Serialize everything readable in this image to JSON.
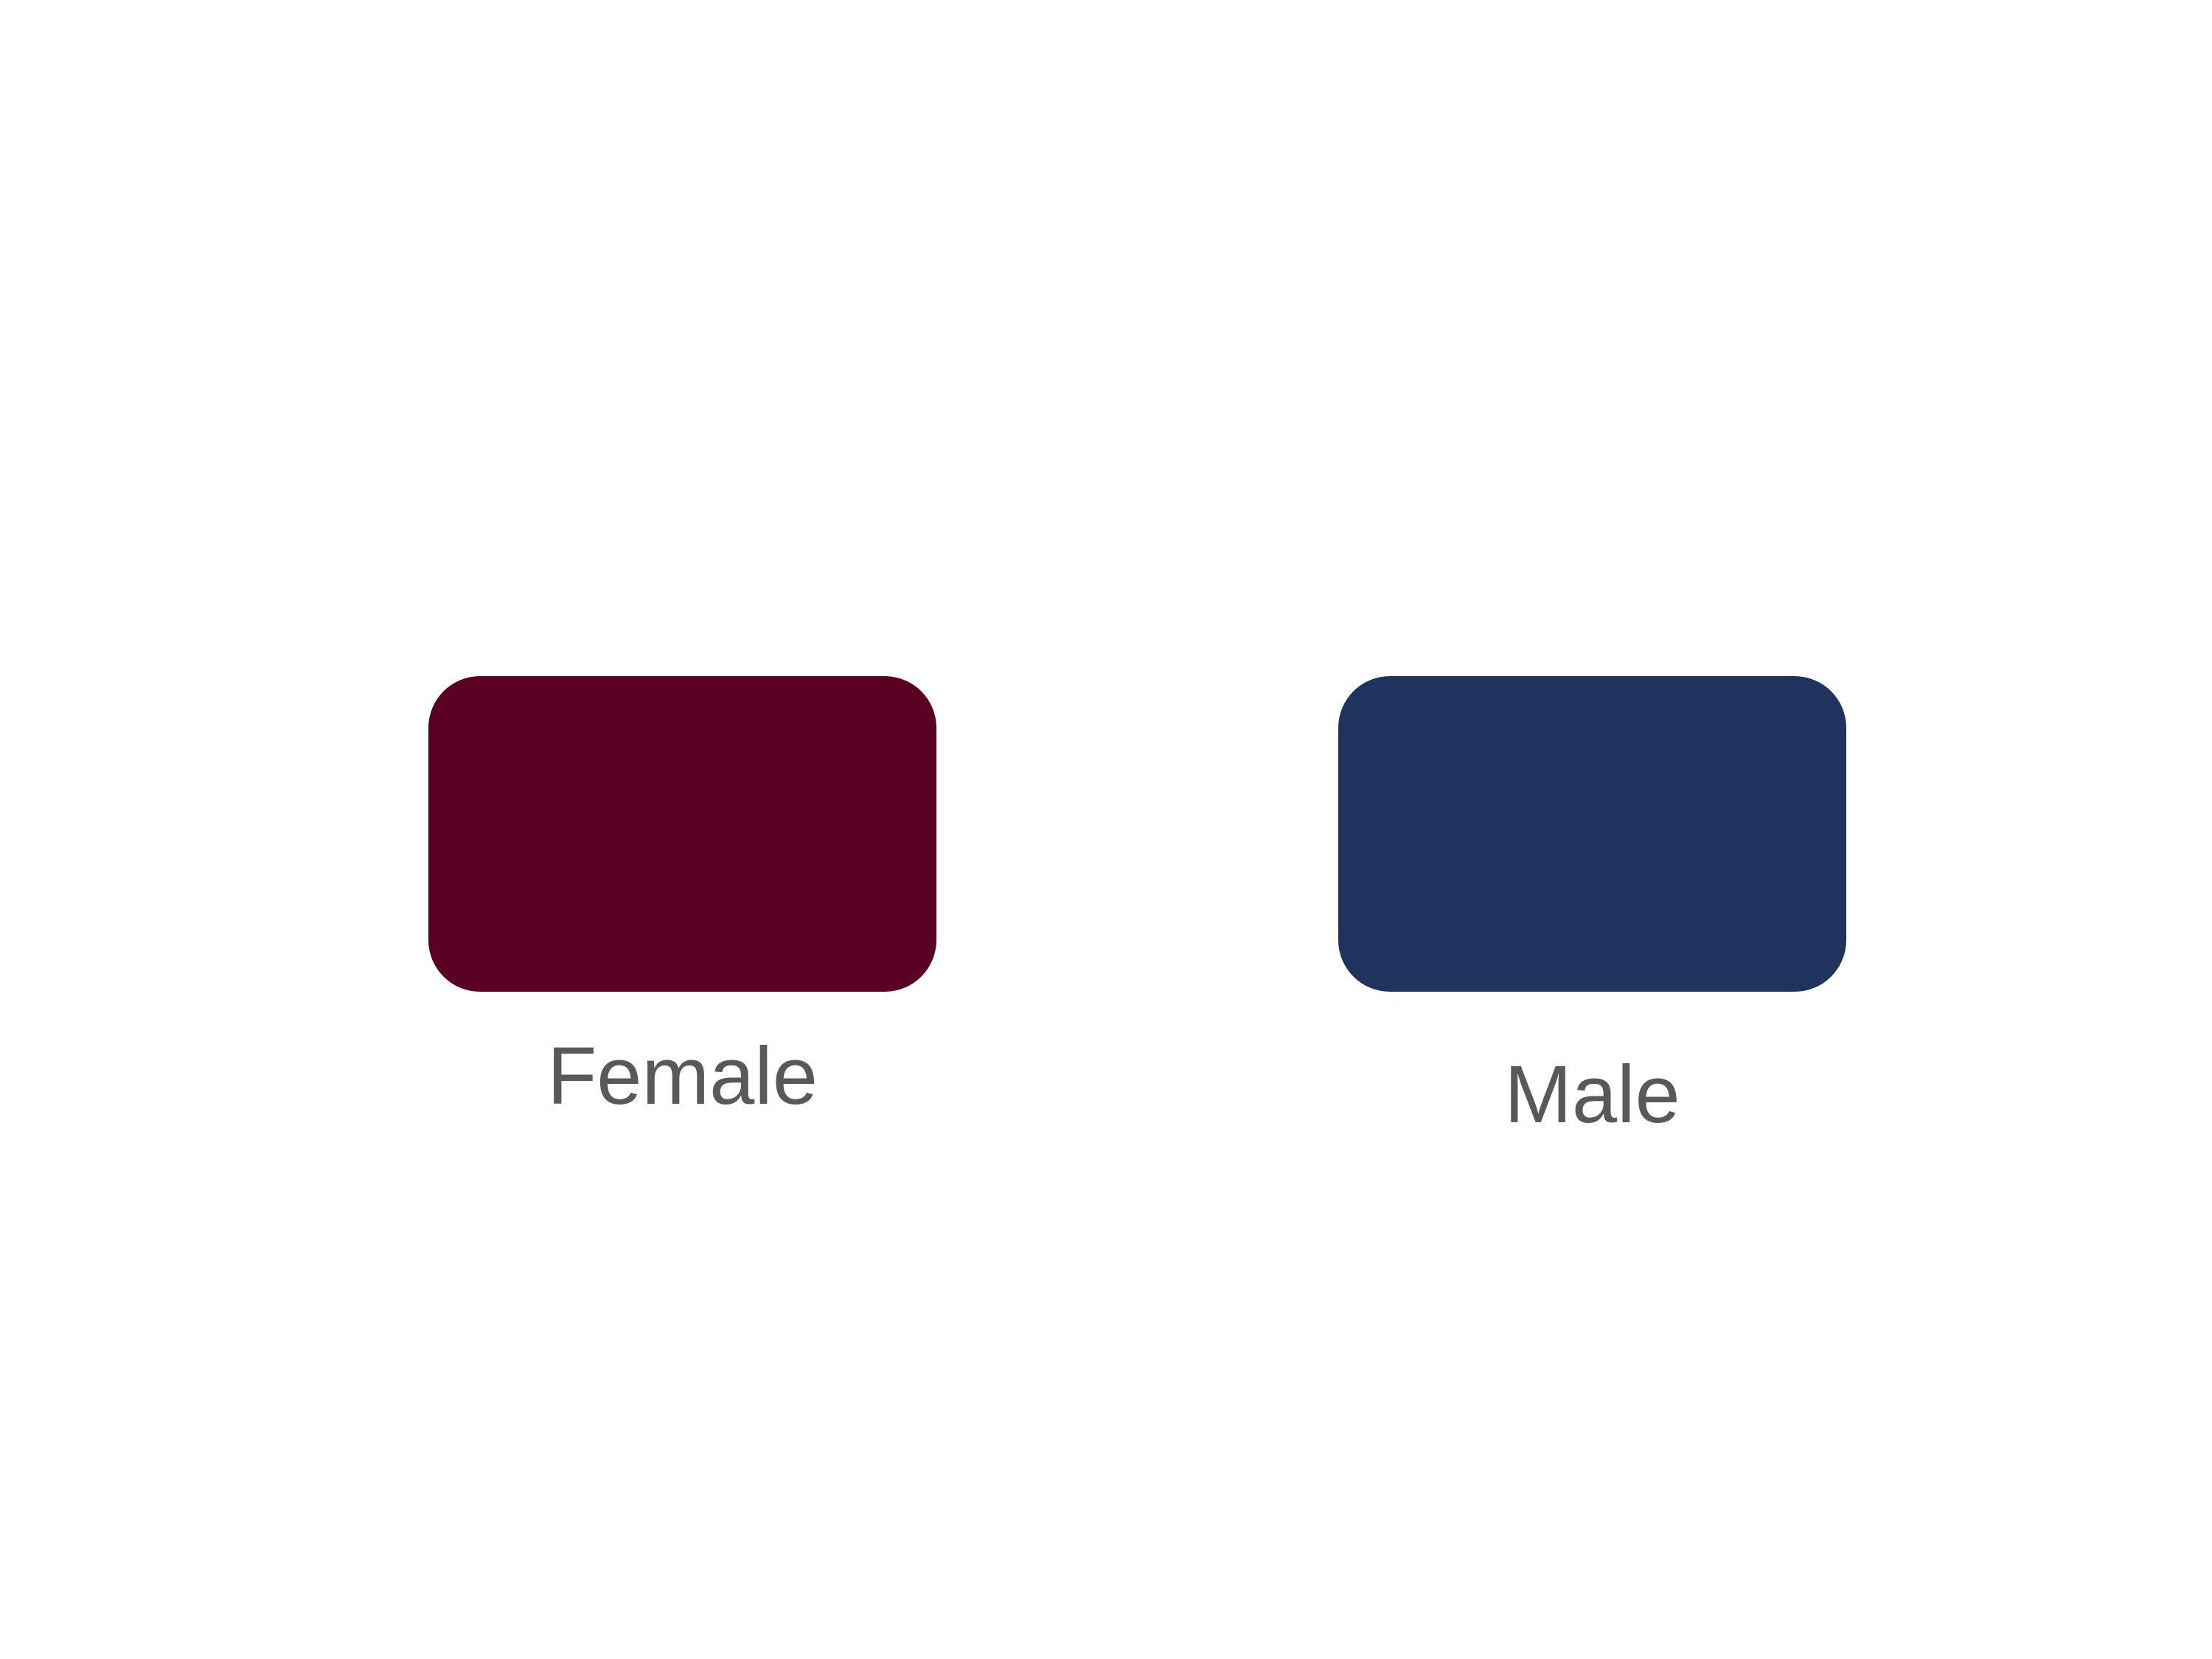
{
  "swatches": [
    {
      "label": "Female",
      "color": "#5A0023"
    },
    {
      "label": "Male",
      "color": "#20335F"
    }
  ]
}
